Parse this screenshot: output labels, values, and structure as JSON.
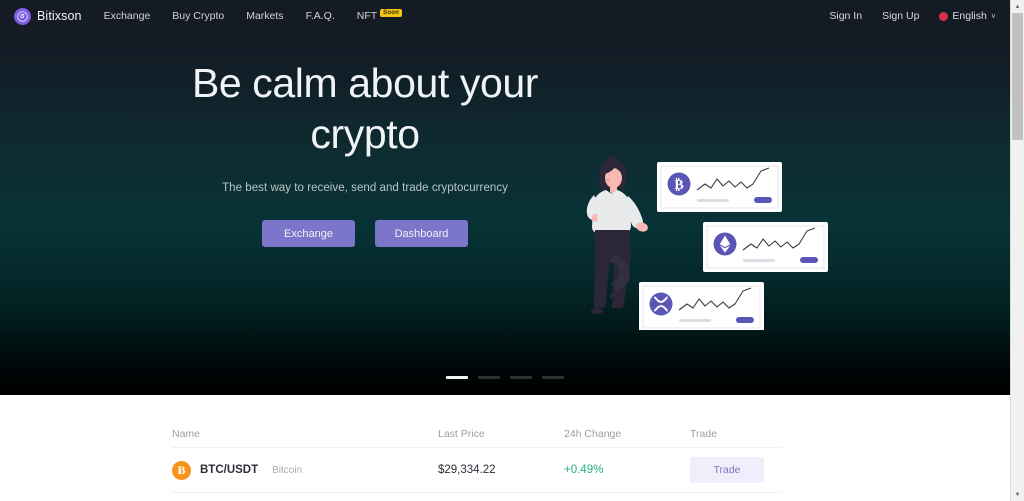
{
  "brand": {
    "name": "Bitixson",
    "icon": "spiral-logo-icon",
    "color": "#7b5fe0"
  },
  "nav": {
    "links": [
      {
        "label": "Exchange"
      },
      {
        "label": "Buy Crypto"
      },
      {
        "label": "Markets"
      },
      {
        "label": "F.A.Q."
      },
      {
        "label": "NFT",
        "badge": "Soon"
      }
    ],
    "sign_in": "Sign In",
    "sign_up": "Sign Up",
    "language": "English",
    "language_caret": "∨",
    "flag_icon": "flag-circle-icon"
  },
  "hero": {
    "title_line1": "Be calm about your",
    "title_line2": "crypto",
    "subtitle": "The best way to receive, send and trade cryptocurrency",
    "primary_button": "Exchange",
    "secondary_button": "Dashboard",
    "accent_color": "#7b76c9",
    "illustration": {
      "name": "person-with-crypto-charts-illustration",
      "cards": [
        {
          "coin": "bitcoin",
          "symbol": "Ƀ",
          "icon": "bitcoin-icon"
        },
        {
          "coin": "ethereum",
          "symbol": "Ξ",
          "icon": "ethereum-icon"
        },
        {
          "coin": "ripple",
          "symbol": "✕",
          "icon": "xrp-icon"
        }
      ]
    },
    "carousel": {
      "count": 4,
      "active_index": 0
    }
  },
  "market": {
    "columns": [
      "Name",
      "Last Price",
      "24h Change",
      "Trade"
    ],
    "rows": [
      {
        "icon": "bitcoin-icon",
        "symbol": "Ƀ",
        "pair": "BTC/USDT",
        "coin_name": "Bitcoin",
        "last_price": "$29,334.22",
        "change": "+0.49%",
        "change_color": "#22b07d",
        "trade_label": "Trade"
      }
    ]
  },
  "scrollbar": {
    "up_arrow": "▲",
    "down_arrow": "▼"
  }
}
